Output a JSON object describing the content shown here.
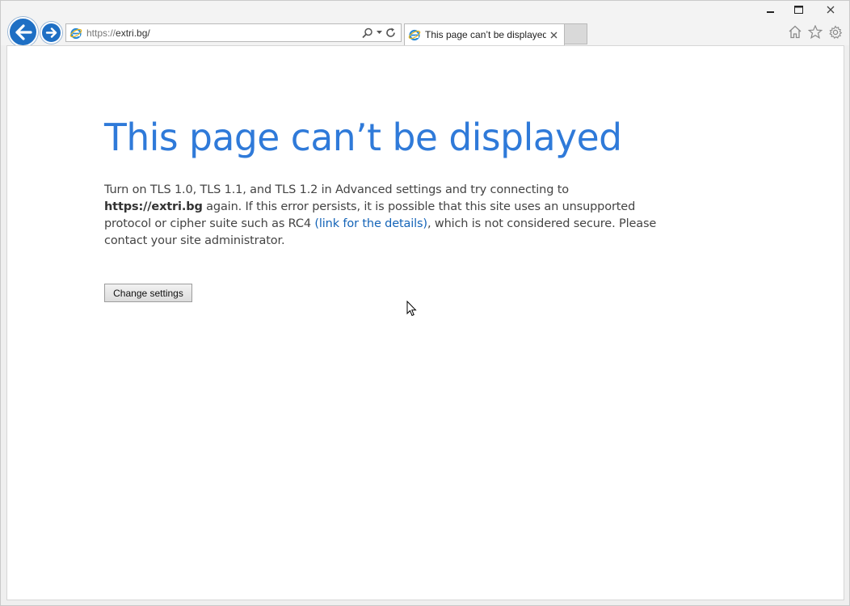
{
  "address_bar": {
    "url_protocol": "https://",
    "url_host": "extri.bg/"
  },
  "tab": {
    "title": "This page can’t be displayed"
  },
  "page": {
    "title": "This page can’t be displayed",
    "message_part1": "Turn on TLS 1.0, TLS 1.1, and TLS 1.2 in Advanced settings and try connecting to ",
    "message_site": "https://extri.bg",
    "message_part2": " again. If this error persists, it is possible that this site uses an unsupported protocol or cipher suite such as RC4 ",
    "message_link": "(link for the details)",
    "message_part3": ", which is not considered secure. Please contact your site administrator.",
    "button_label": "Change settings"
  },
  "icons": {
    "back": "back-arrow-icon",
    "forward": "forward-arrow-icon",
    "ie": "internet-explorer-icon",
    "search": "search-icon",
    "refresh": "refresh-icon",
    "home": "home-icon",
    "favorites": "star-icon",
    "settings": "gear-icon"
  },
  "colors": {
    "title_blue": "#2f7ad9",
    "link_blue": "#1464b8",
    "nav_blue": "#1e6fc4"
  }
}
